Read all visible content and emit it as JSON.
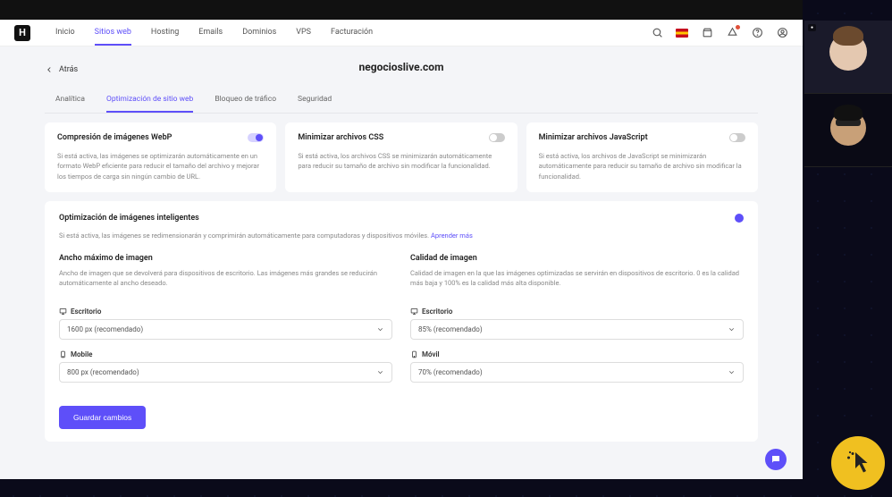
{
  "nav": {
    "items": [
      "Inicio",
      "Sitios web",
      "Hosting",
      "Emails",
      "Dominios",
      "VPS",
      "Facturación"
    ],
    "active_index": 1
  },
  "back_label": "Atrás",
  "page_title": "negocioslive.com",
  "tabs": {
    "items": [
      "Analítica",
      "Optimización de sitio web",
      "Bloqueo de tráfico",
      "Seguridad"
    ],
    "active_index": 1
  },
  "cards": [
    {
      "title": "Compresión de imágenes WebP",
      "desc": "Si está activa, las imágenes se optimizarán automáticamente en un formato WebP eficiente para reducir el tamaño del archivo y mejorar los tiempos de carga sin ningún cambio de URL.",
      "on": true
    },
    {
      "title": "Minimizar archivos CSS",
      "desc": "Si está activa, los archivos CSS se minimizarán automáticamente para reducir su tamaño de archivo sin modificar la funcionalidad.",
      "on": false
    },
    {
      "title": "Minimizar archivos JavaScript",
      "desc": "Si está activa, los archivos de JavaScript se minimizarán automáticamente para reducir su tamaño de archivo sin modificar la funcionalidad.",
      "on": false
    }
  ],
  "smart": {
    "title": "Optimización de imágenes inteligentes",
    "desc": "Si está activa, las imágenes se redimensionarán y comprimirán automáticamente para computadoras y dispositivos móviles.",
    "learn_more": "Aprender más",
    "on": true,
    "cols": [
      {
        "title": "Ancho máximo de imagen",
        "desc": "Ancho de imagen que se devolverá para dispositivos de escritorio. Las imágenes más grandes se reducirán automáticamente al ancho deseado.",
        "fields": [
          {
            "label": "Escritorio",
            "value": "1600 px (recomendado)"
          },
          {
            "label": "Mobile",
            "value": "800 px (recomendado)"
          }
        ]
      },
      {
        "title": "Calidad de imagen",
        "desc": "Calidad de imagen en la que las imágenes optimizadas se servirán en dispositivos de escritorio. 0 es la calidad más baja y 100% es la calidad más alta disponible.",
        "fields": [
          {
            "label": "Escritorio",
            "value": "85% (recomendado)"
          },
          {
            "label": "Móvil",
            "value": "70% (recomendado)"
          }
        ]
      }
    ]
  },
  "save_label": "Guardar cambios",
  "colors": {
    "accent": "#5e4ff9"
  }
}
